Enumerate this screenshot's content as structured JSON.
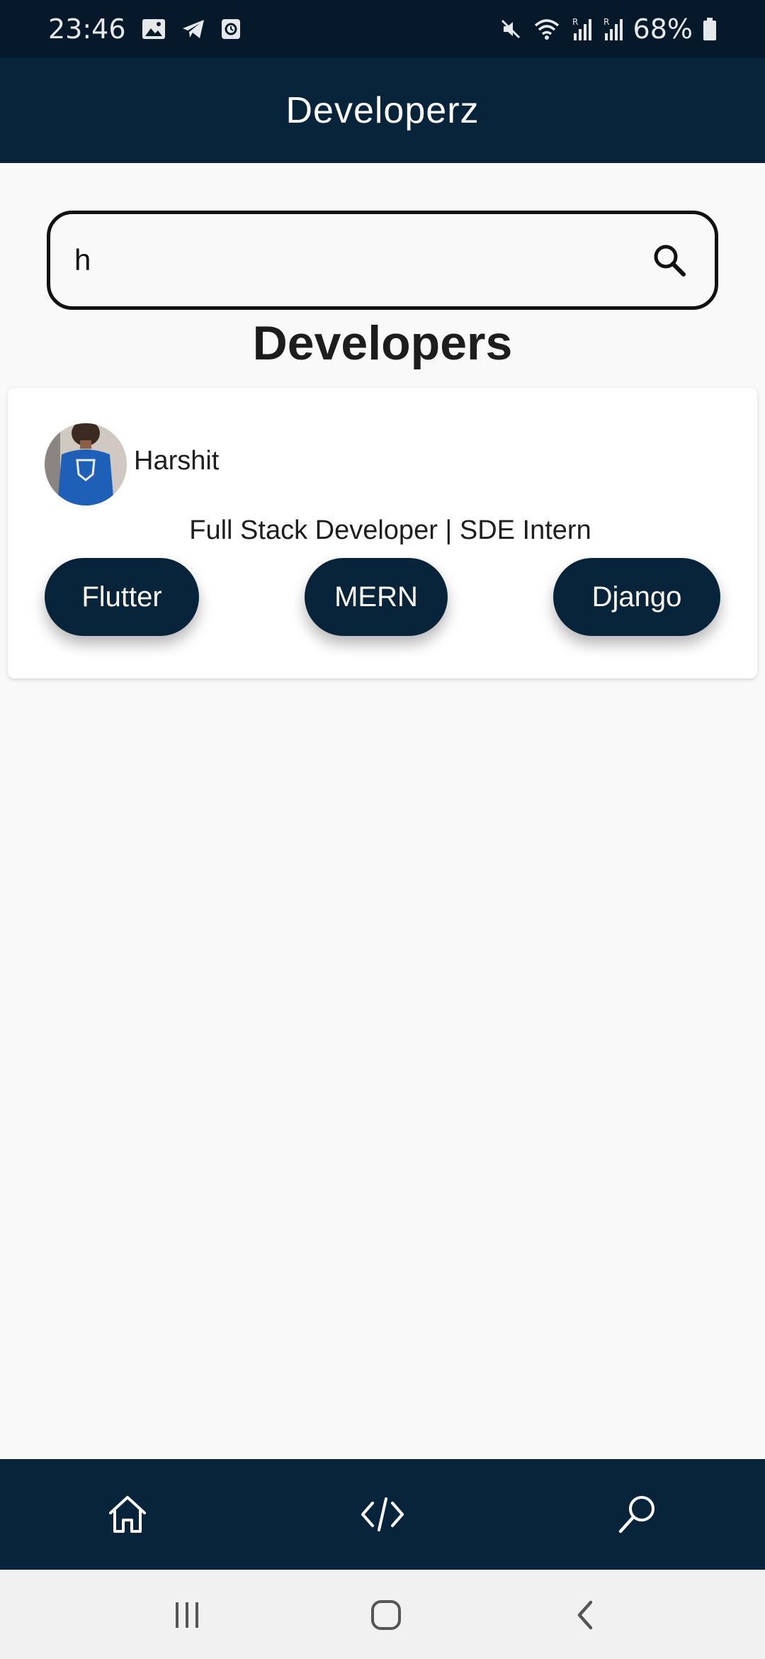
{
  "status_bar": {
    "time": "23:46",
    "battery": "68%",
    "icons": [
      "gallery-icon",
      "telegram-icon",
      "clock-app-icon",
      "mute-icon",
      "wifi-icon",
      "signal-icon",
      "signal-icon",
      "battery-icon"
    ]
  },
  "app_bar": {
    "title": "Developerz"
  },
  "search": {
    "value": "h",
    "icon": "search-icon"
  },
  "section": {
    "title": "Developers"
  },
  "developers": [
    {
      "name": "Harshit",
      "role": "Full Stack Developer | SDE Intern",
      "tags": [
        "Flutter",
        "MERN",
        "Django"
      ]
    }
  ],
  "bottom_nav": {
    "items": [
      "home-icon",
      "code-icon",
      "search-icon"
    ]
  },
  "system_nav": {
    "items": [
      "recent-apps-icon",
      "home-button-icon",
      "back-icon"
    ]
  },
  "colors": {
    "primary": "#08243a",
    "status_bar": "#06192a",
    "background": "#f9f9f9"
  }
}
